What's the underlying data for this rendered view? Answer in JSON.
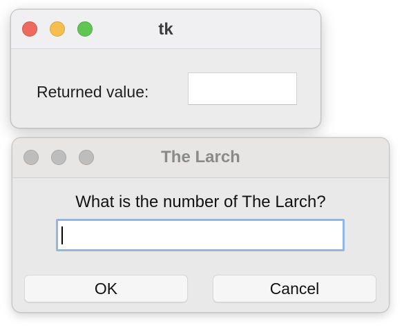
{
  "windows": {
    "main": {
      "title": "tk",
      "returned_value_label": "Returned value:",
      "returned_value": ""
    },
    "dialog": {
      "title": "The Larch",
      "prompt": "What is the number of The Larch?",
      "input_value": "",
      "ok_label": "OK",
      "cancel_label": "Cancel"
    }
  },
  "colors": {
    "close": "#ed6a5e",
    "minimize": "#f5bf4f",
    "zoom": "#61c554",
    "inactive_traffic": "#bdbdbd",
    "focus_ring": "#8fb6e5"
  },
  "icons": {
    "close": "close-icon",
    "minimize": "minimize-icon",
    "zoom": "zoom-icon"
  }
}
